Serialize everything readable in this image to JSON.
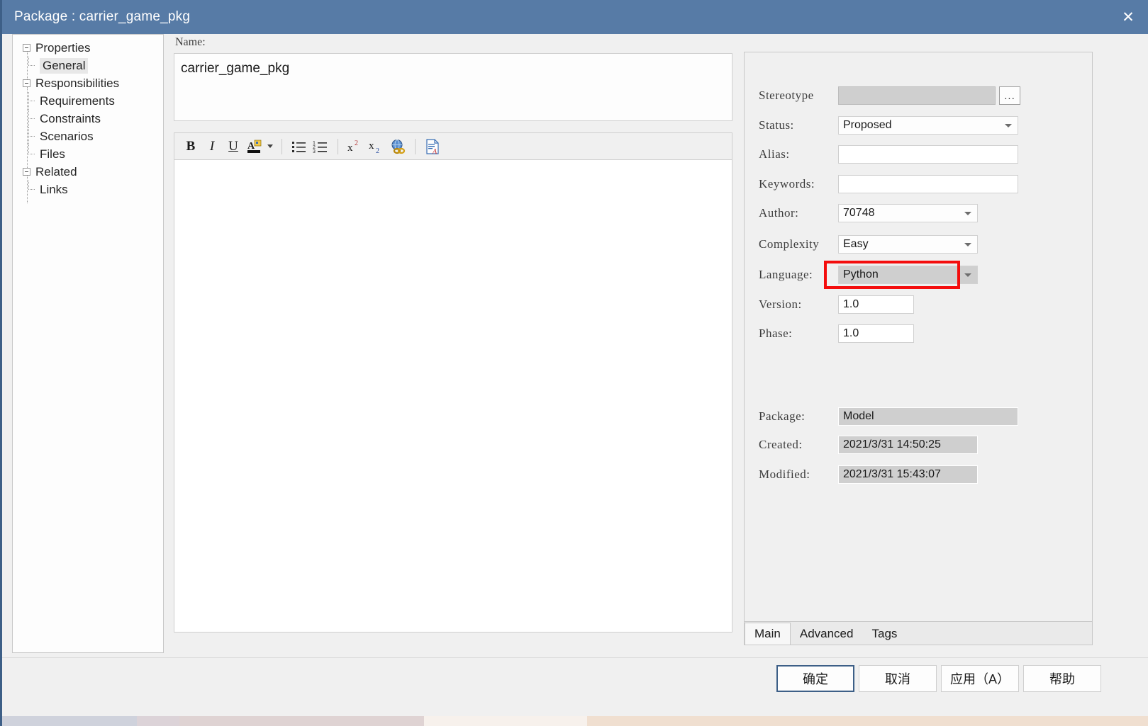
{
  "window": {
    "title": "Package : carrier_game_pkg",
    "close_icon": "close-icon"
  },
  "tree": {
    "items": [
      {
        "label": "Properties",
        "level": 0,
        "expanded": true,
        "selected": false
      },
      {
        "label": "General",
        "level": 1,
        "expanded": false,
        "selected": true
      },
      {
        "label": "Responsibilities",
        "level": 0,
        "expanded": true,
        "selected": false
      },
      {
        "label": "Requirements",
        "level": 1,
        "expanded": false,
        "selected": false
      },
      {
        "label": "Constraints",
        "level": 1,
        "expanded": false,
        "selected": false
      },
      {
        "label": "Scenarios",
        "level": 1,
        "expanded": false,
        "selected": false
      },
      {
        "label": "Files",
        "level": 1,
        "expanded": false,
        "selected": false
      },
      {
        "label": "Related",
        "level": 0,
        "expanded": true,
        "selected": false
      },
      {
        "label": "Links",
        "level": 1,
        "expanded": false,
        "selected": false
      }
    ]
  },
  "name_section": {
    "label": "Name:",
    "value": "carrier_game_pkg"
  },
  "editor": {
    "content": "",
    "toolbar": [
      {
        "name": "bold-icon",
        "glyph": "B"
      },
      {
        "name": "italic-icon",
        "glyph": "I"
      },
      {
        "name": "underline-icon",
        "glyph": "U"
      },
      {
        "name": "font-color-icon",
        "glyph": "A"
      },
      {
        "name": "bullet-list-icon",
        "glyph": "≡"
      },
      {
        "name": "numbered-list-icon",
        "glyph": "≡"
      },
      {
        "name": "superscript-icon",
        "glyph": "x"
      },
      {
        "name": "subscript-icon",
        "glyph": "x"
      },
      {
        "name": "hyperlink-icon",
        "glyph": "ἱ0"
      },
      {
        "name": "insert-document-icon",
        "glyph": "☷"
      }
    ]
  },
  "properties": {
    "stereotype": {
      "label": "Stereotype",
      "value": "",
      "browse_label": "..."
    },
    "status": {
      "label": "Status:",
      "value": "Proposed"
    },
    "alias": {
      "label": "Alias:",
      "value": ""
    },
    "keywords": {
      "label": "Keywords:",
      "value": ""
    },
    "author": {
      "label": "Author:",
      "value": "70748"
    },
    "complexity": {
      "label": "Complexity",
      "value": "Easy"
    },
    "language": {
      "label": "Language:",
      "value": "Python",
      "highlighted": true
    },
    "version": {
      "label": "Version:",
      "value": "1.0"
    },
    "phase": {
      "label": "Phase:",
      "value": "1.0"
    },
    "package": {
      "label": "Package:",
      "value": "Model"
    },
    "created": {
      "label": "Created:",
      "value": "2021/3/31 14:50:25"
    },
    "modified": {
      "label": "Modified:",
      "value": "2021/3/31 15:43:07"
    }
  },
  "tabs": [
    {
      "label": "Main",
      "active": true
    },
    {
      "label": "Advanced",
      "active": false
    },
    {
      "label": "Tags",
      "active": false
    }
  ],
  "footer_buttons": [
    {
      "label": "确定",
      "default": true
    },
    {
      "label": "取消",
      "default": false
    },
    {
      "label": "应用（A）",
      "default": false
    },
    {
      "label": "帮助",
      "default": false
    }
  ],
  "colors": {
    "titlebar": "#577ba6",
    "highlight": "#f40d0d",
    "panel": "#f0f0f0",
    "readonly_field": "#cfcfcf"
  }
}
